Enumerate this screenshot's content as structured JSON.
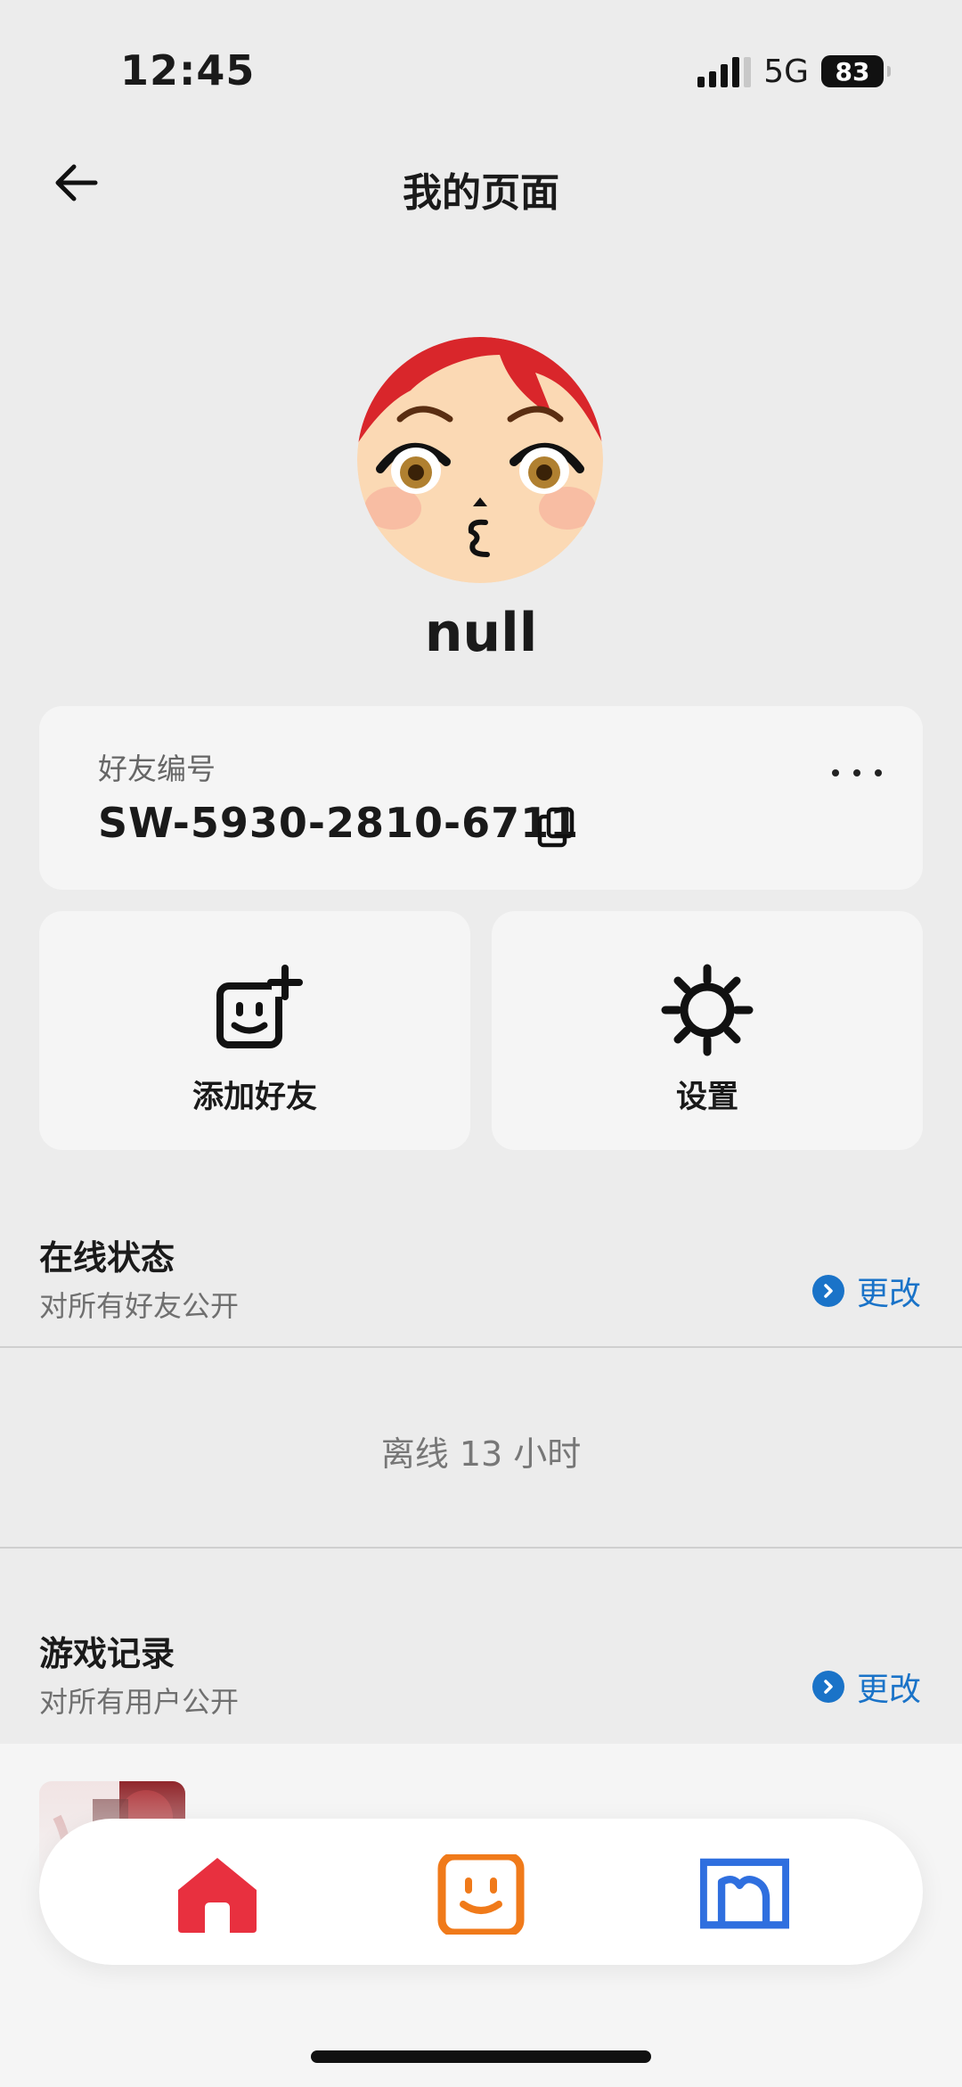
{
  "status_bar": {
    "time": "12:45",
    "network": "5G",
    "battery": "83"
  },
  "header": {
    "title": "我的页面",
    "back_icon": "arrow-left-icon"
  },
  "profile": {
    "username": "null",
    "avatar_icon": "mii-avatar"
  },
  "friend_card": {
    "label": "好友编号",
    "code": "SW-5930-2810-6711",
    "copy_icon": "copy-icon",
    "more_icon": "more-horizontal-icon"
  },
  "actions": {
    "add_friend": "添加好友",
    "settings": "设置"
  },
  "online_status": {
    "title": "在线状态",
    "subtitle": "对所有好友公开",
    "change": "更改",
    "status_text": "离线 13 小时"
  },
  "game_records": {
    "title": "游戏记录",
    "subtitle": "对所有用户公开",
    "change": "更改"
  },
  "bottom_nav": {
    "items": [
      {
        "icon": "home-icon",
        "color": "#e8303f"
      },
      {
        "icon": "friends-face-icon",
        "color": "#f07a1a"
      },
      {
        "icon": "mii-store-icon",
        "color": "#2f6fdf"
      }
    ]
  },
  "colors": {
    "accent_blue": "#1a73c8",
    "background": "#ececec",
    "card": "#f5f5f5"
  }
}
